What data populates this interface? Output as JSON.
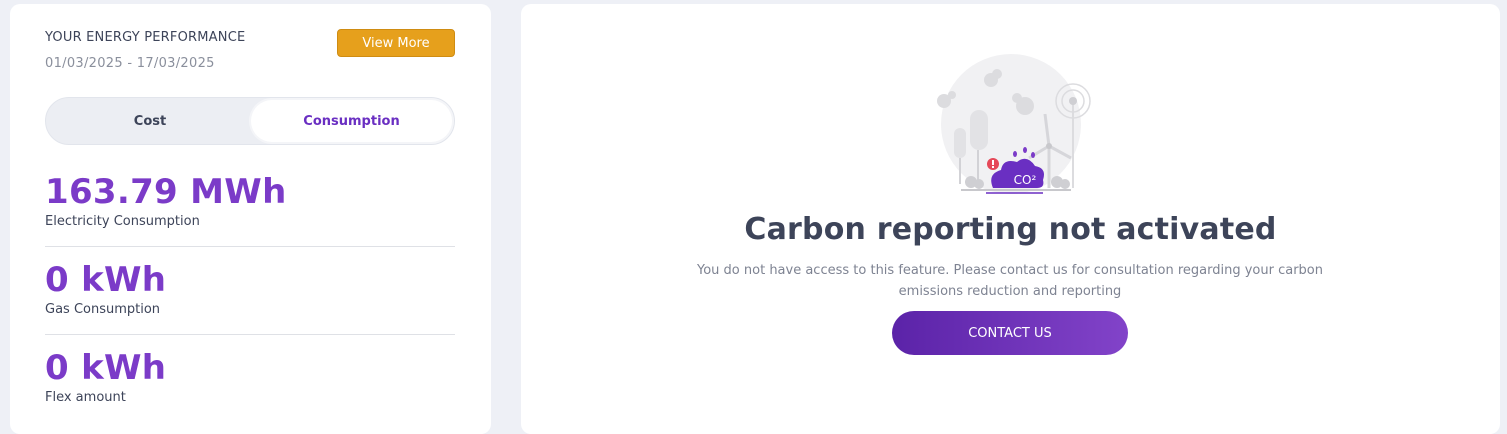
{
  "performance": {
    "title": "YOUR ENERGY PERFORMANCE",
    "date_range": "01/03/2025 - 17/03/2025",
    "view_more_label": "View More",
    "toggle": {
      "options": [
        "Cost",
        "Consumption"
      ],
      "selected": "Consumption"
    },
    "metrics": [
      {
        "value": "163.79 MWh",
        "label": "Electricity Consumption"
      },
      {
        "value": "0 kWh",
        "label": "Gas Consumption"
      },
      {
        "value": "0 kWh",
        "label": "Flex amount"
      }
    ]
  },
  "carbon": {
    "illustration_icon": "co2-factory-wind-illustration",
    "co2_label": "CO²",
    "title": "Carbon reporting not activated",
    "description": "You do not have access to this feature. Please contact us for consultation regarding your carbon emissions reduction and reporting",
    "contact_label": "CONTACT US"
  },
  "colors": {
    "accent_purple": "#7b3bc8",
    "button_orange": "#e6a01c",
    "background": "#eef0f6"
  }
}
